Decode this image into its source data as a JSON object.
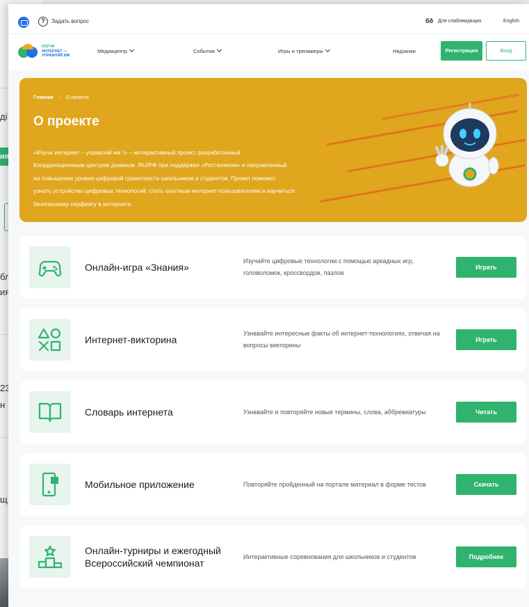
{
  "background_fragments": [
    "ді",
    "ия",
    "бл",
    "ия",
    "23",
    "н",
    "щ"
  ],
  "topbar": {
    "ask_label": "Задать вопрос",
    "visually_impaired_icon": "бð",
    "visually_impaired_label": "Для слабовидящих",
    "language_label": "English"
  },
  "nav": {
    "brand_lines": [
      "ИЗУЧИ",
      "ИНТЕРНЕТ —",
      "УПРАВЛЯЙ ИМ"
    ],
    "items": [
      {
        "label": "Медиацентр"
      },
      {
        "label": "События"
      },
      {
        "label": "Игры и тренажеры"
      },
      {
        "label": "Нидзачки"
      }
    ],
    "register_label": "Регистрация",
    "login_label": "Вход"
  },
  "hero": {
    "breadcrumb_home": "Главная",
    "breadcrumb_sep": "›",
    "breadcrumb_current": "О проекте",
    "title": "О проекте",
    "description_lines": [
      "«Изучи интернет – управляй им !» – интерактивный проект, разработанный",
      "Координационным центром доменов .RU/РФ при поддержке «Ростелеком» и направленный",
      "на повышение уровня цифровой грамотности школьников и студентов. Проект поможет",
      "узнать устройство цифровых технологий, стать опытным интернет-пользователем и научиться",
      "безопасному серфингу в интернете."
    ],
    "colors": {
      "background": "#e0a61e",
      "stripes": "#e46d1d"
    }
  },
  "cards": [
    {
      "icon": "gamepad-icon",
      "title": "Онлайн-игра «Знания»",
      "description": "Изучайте цифровые технологии с помощью аркадных игр, головоломок, кроссвордов, пазлов",
      "button": "Играть"
    },
    {
      "icon": "shapes-icon",
      "title": "Интернет-викторина",
      "description": "Узнавайте интересные факты об интернет-технологиях, отвечая на вопросы викторины",
      "button": "Играть"
    },
    {
      "icon": "book-icon",
      "title": "Словарь интернета",
      "description": "Узнавайте и повторяйте новые термины, слова, аббревиатуры",
      "button": "Читать"
    },
    {
      "icon": "mobile-icon",
      "title": "Мобильное приложение",
      "description": "Повторяйте пройденный на портале материал в форме тестов",
      "button": "Скачать"
    },
    {
      "icon": "podium-icon",
      "title": "Онлайн-турниры и ежегодный Всероссийский чемпионат",
      "description": "Интерактивные соревнования для школьников и студентов",
      "button": "Подробнее"
    }
  ],
  "colors": {
    "accent": "#2fb36f",
    "brand_blue": "#1f6fe5"
  }
}
